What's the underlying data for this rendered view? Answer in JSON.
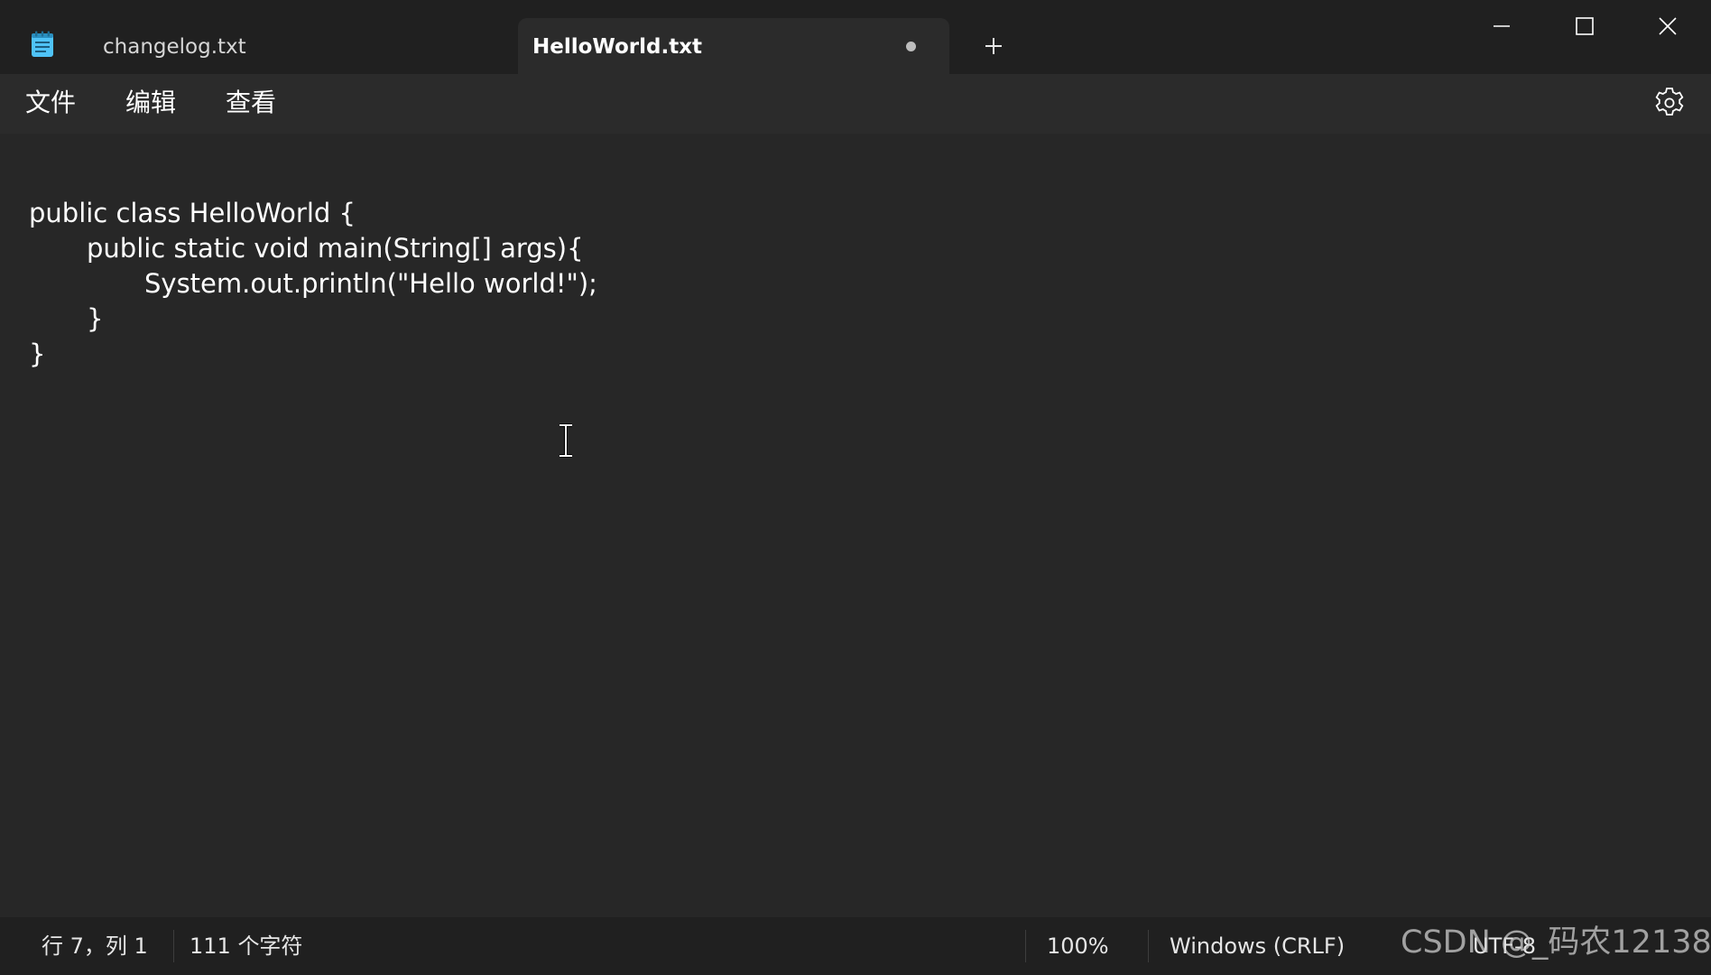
{
  "tabs": [
    {
      "label": "changelog.txt",
      "active": false
    },
    {
      "label": "HelloWorld.txt",
      "active": true,
      "unsaved": true
    }
  ],
  "menu": {
    "file": "文件",
    "edit": "编辑",
    "view": "查看"
  },
  "editor": {
    "lines": [
      "public class HelloWorld {",
      "public static void main(String[] args){",
      "System.out.println(\"Hello world!\");",
      "}",
      "}"
    ]
  },
  "status": {
    "position": "行 7，列 1",
    "char_count": "111 个字符",
    "zoom": "100%",
    "line_ending": "Windows (CRLF)",
    "encoding": "UTF-8"
  },
  "watermark": "CSDN @_码农12138",
  "icons": {
    "app": "notepad-icon",
    "new_tab": "plus-icon",
    "minimize": "minimize-icon",
    "maximize": "maximize-icon",
    "close": "close-icon",
    "settings": "gear-icon",
    "cursor": "text-cursor-icon"
  },
  "colors": {
    "background": "#272727",
    "titlebar": "#202020",
    "active_tab": "#2b2b2b",
    "app_icon": "#4fc3f7"
  }
}
